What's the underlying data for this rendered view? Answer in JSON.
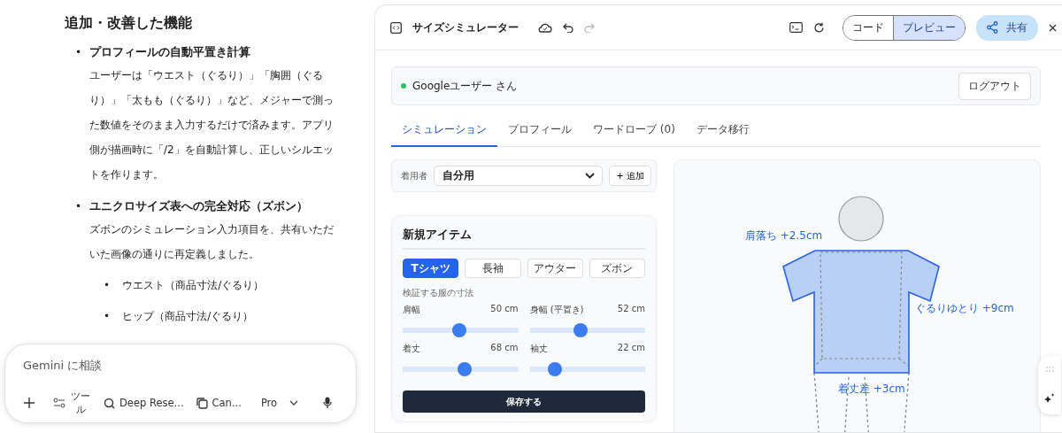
{
  "chat": {
    "heading": "追加・改善した機能",
    "items": [
      {
        "bullet": "•",
        "title": "プロフィールの自動平置き計算",
        "body": "ユーザーは「ウエスト（ぐるり）」「胸囲（ぐるり）」「太もも（ぐるり）」など、メジャーで測った数値をそのまま入力するだけで済みます。アプリ側が描画時に「/2」を自動計算し、正しいシルエットを作ります。"
      },
      {
        "bullet": "•",
        "title": "ユニクロサイズ表への完全対応（ズボン）",
        "body": "ズボンのシミュレーション入力項目を、共有いただいた画像の通りに再定義しました。",
        "subitems": [
          {
            "bullet": "•",
            "text": "ウエスト（商品寸法/ぐるり）"
          },
          {
            "bullet": "•",
            "text": "ヒップ（商品寸法/ぐるり）"
          }
        ]
      }
    ]
  },
  "composer": {
    "placeholder": "Gemini に相談",
    "tools": "ツール",
    "deep_research": "Deep Rese...",
    "canvas": "Can...",
    "model": "Pro"
  },
  "canvas": {
    "title": "サイズシミュレーター",
    "view_toggle": [
      {
        "label": "コード",
        "selected": false
      },
      {
        "label": "プレビュー",
        "selected": true
      }
    ],
    "share": "共有",
    "app": {
      "user": "Googleユーザー さん",
      "logout": "ログアウト",
      "tabs": [
        {
          "label": "シミュレーション",
          "selected": true
        },
        {
          "label": "プロフィール",
          "selected": false
        },
        {
          "label": "ワードローブ (0)",
          "selected": false
        },
        {
          "label": "データ移行",
          "selected": false
        }
      ],
      "wearer_label": "着用者",
      "wearer_value": "自分用",
      "add": "+ 追加",
      "card_title": "新規アイテム",
      "types": [
        {
          "label": "Tシャツ",
          "selected": true
        },
        {
          "label": "長袖",
          "selected": false
        },
        {
          "label": "アウター",
          "selected": false
        },
        {
          "label": "ズボン",
          "selected": false
        }
      ],
      "section_label": "検証する服の寸法",
      "sliders": [
        {
          "name": "肩幅",
          "reading": "50 cm",
          "level": 0.49
        },
        {
          "name": "身幅 (平置き)",
          "reading": "52 cm",
          "level": 0.44
        },
        {
          "name": "着丈",
          "reading": "68 cm",
          "level": 0.54
        },
        {
          "name": "袖丈",
          "reading": "22 cm",
          "level": 0.22
        }
      ],
      "save": "保存する",
      "annotations": [
        "肩落ち +2.5cm",
        "ぐるりゆとり +9cm",
        "着丈差 +3cm"
      ]
    }
  }
}
